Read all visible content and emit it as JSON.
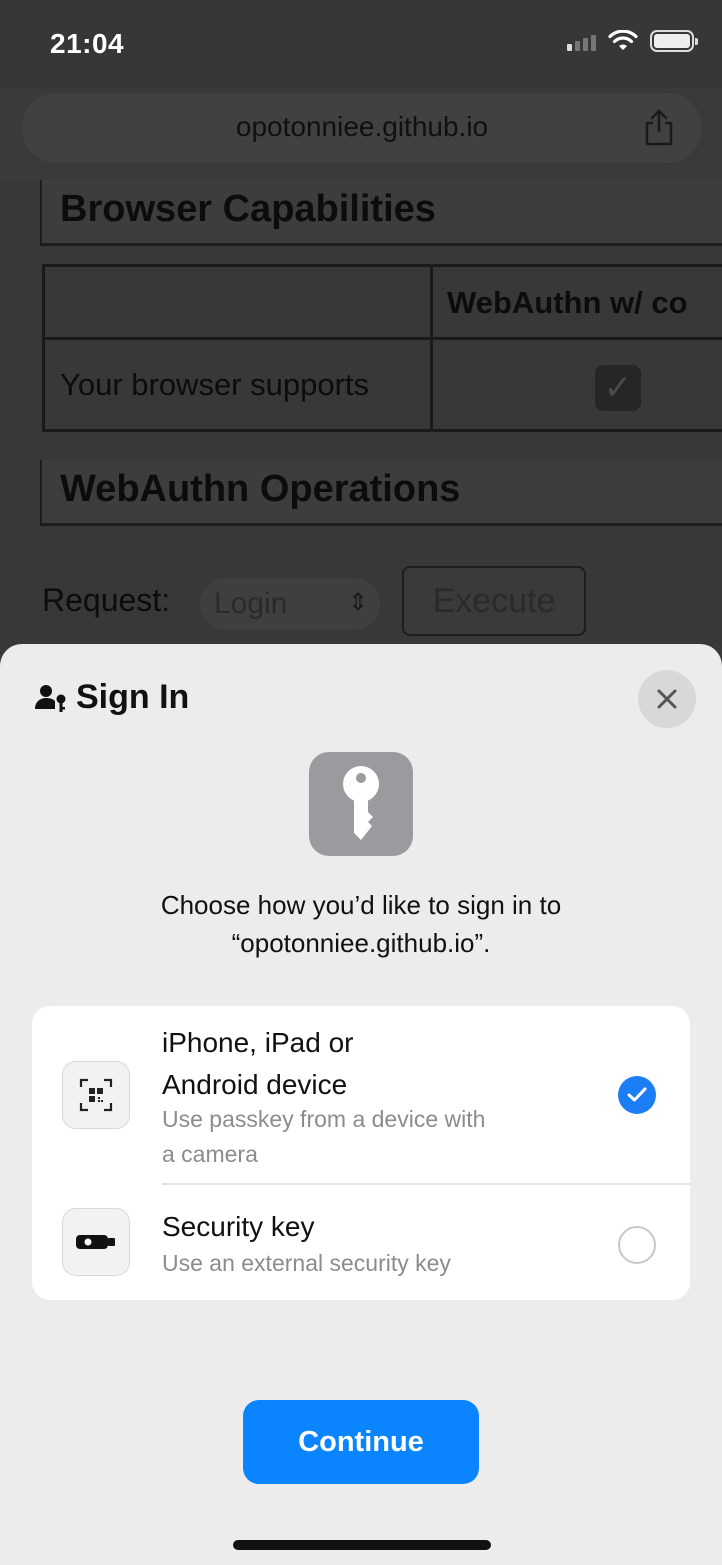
{
  "status_bar": {
    "time": "21:04",
    "icons": [
      "signal-icon",
      "wifi-icon",
      "battery-icon"
    ]
  },
  "browser": {
    "url": "opotonniee.github.io",
    "share_icon": "share-icon"
  },
  "page": {
    "capabilities_heading": "Browser Capabilities",
    "table": {
      "column_header": "WebAuthn w/ co",
      "row_label": "Your browser supports",
      "checkbox_glyph": "✓"
    },
    "operations_heading": "WebAuthn Operations",
    "request_label": "Request:",
    "request_value": "Login",
    "execute_label": "Execute"
  },
  "sheet": {
    "title": "Sign In",
    "title_icon": "person-key-icon",
    "close_icon": "close-icon",
    "hero_icon": "key-icon",
    "prompt_line1": "Choose how you’d like to sign in to",
    "prompt_line2": "“opotonniee.github.io”.",
    "options": [
      {
        "title_line1": "iPhone, iPad or",
        "title_line2": "Android device",
        "subtitle_line1": "Use passkey from a device with",
        "subtitle_line2": "a camera",
        "icon": "qr-code-icon",
        "selected": true
      },
      {
        "title_line1": "Security key",
        "subtitle_line1": "Use an external security key",
        "icon": "security-key-icon",
        "selected": false
      }
    ],
    "continue_label": "Continue"
  },
  "colors": {
    "accent": "#0b84ff",
    "sheet_bg": "#ececec",
    "dim_bg": "#3a3a3a"
  }
}
